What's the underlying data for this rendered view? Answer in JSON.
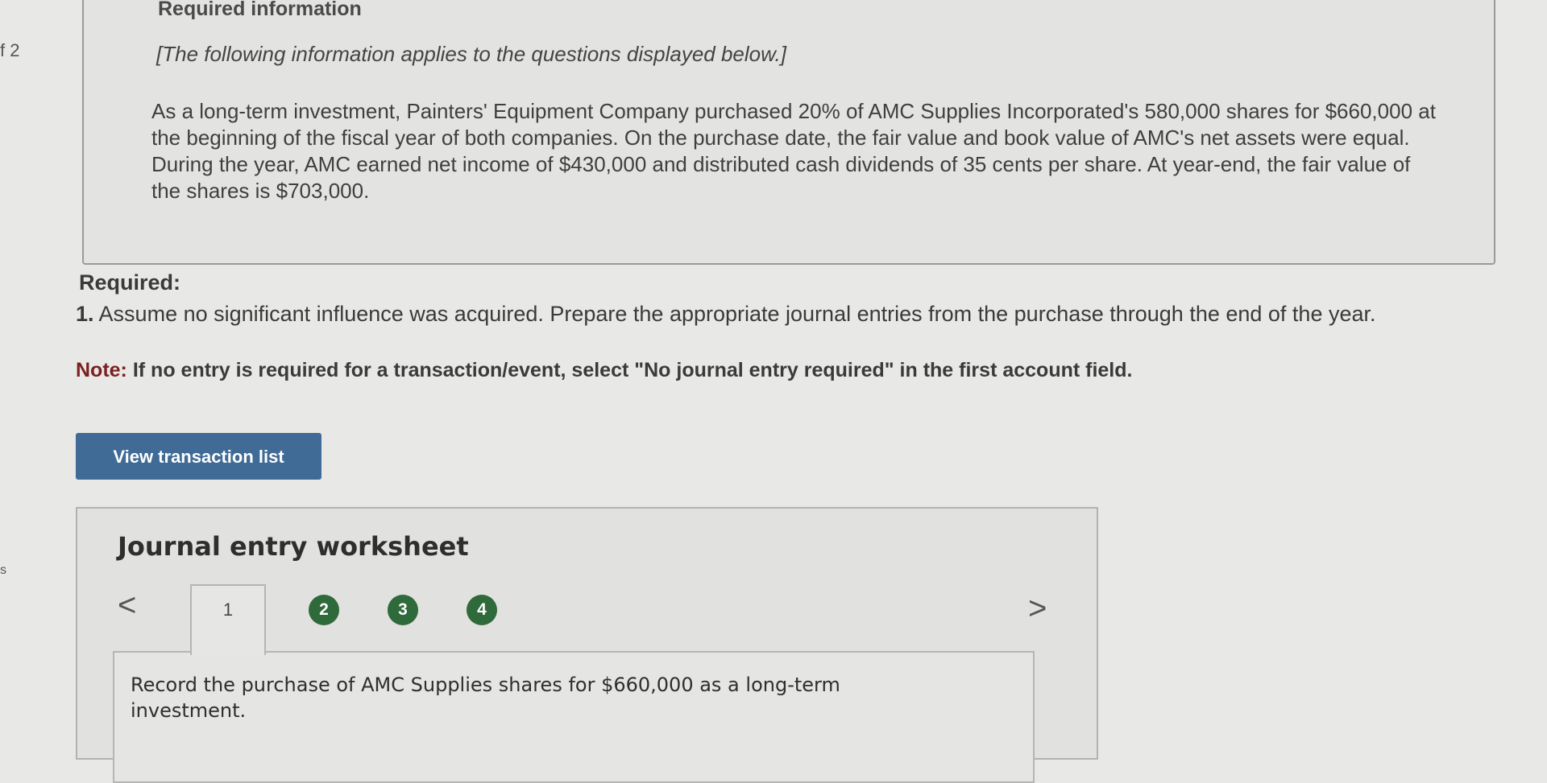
{
  "edge": {
    "number": "f 2",
    "mark": "s"
  },
  "info": {
    "heading": "Required information",
    "intro": "[The following information applies to the questions displayed below.]",
    "paragraph": "As a long-term investment, Painters' Equipment Company purchased 20% of AMC Supplies Incorporated's 580,000 shares for $660,000 at the beginning of the fiscal year of both companies. On the purchase date, the fair value and book value of AMC's net assets were equal. During the year, AMC earned net income of $430,000 and distributed cash dividends of 35 cents per share. At year-end, the fair value of the shares is $703,000."
  },
  "required": {
    "label": "Required:",
    "question_number": "1.",
    "question_text": "Assume no significant influence was acquired. Prepare the appropriate journal entries from the purchase through the end of the year.",
    "note_label": "Note:",
    "note_text": "If no entry is required for a transaction/event, select \"No journal entry required\" in the first account field."
  },
  "buttons": {
    "view_transactions": "View transaction list"
  },
  "worksheet": {
    "title": "Journal entry worksheet",
    "prev_arrow": "<",
    "next_arrow": ">",
    "tabs": [
      "1",
      "2",
      "3",
      "4"
    ],
    "active_tab": "1",
    "tab_color": "#2f6a3a",
    "entry_description": "Record the purchase of AMC Supplies shares for $660,000 as a long-term investment."
  },
  "colors": {
    "button": "#3f6b96",
    "note": "#7a1f1f"
  }
}
